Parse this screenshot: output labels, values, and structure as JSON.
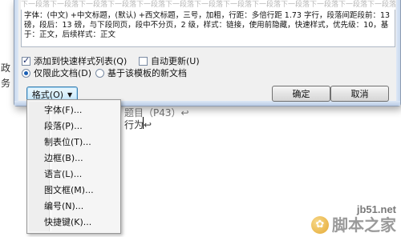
{
  "document": {
    "left_text_1": "政",
    "left_text_2": "务",
    "line_1": "题目（P43）↩",
    "line_2": "行为↩"
  },
  "dialog": {
    "preview_strip": "下一段落下一段落下一段落下一段落下一段落下一段落下一段落下一段落下一段落下一段落下一段落下一段落下一段落下一段落",
    "description": "字体：(中文) +中文标题，(默认) +西文标题，三号，加粗，行距：多倍行距 1.73 字行，段落间距段前：13 磅，段后：13 磅，与下段同页，段中不分页，2 级，样式：链接，使用前隐藏，快速样式，优先级：10，基于：正文，后续样式：正文",
    "add_to_quick_style_label": "添加到快速样式列表(Q)",
    "add_to_quick_style_checked": true,
    "auto_update_label": "自动更新(U)",
    "auto_update_checked": false,
    "only_this_document_label": "仅限此文档(D)",
    "only_this_document_selected": true,
    "template_based_label": "基于该模板的新文档",
    "template_based_selected": false,
    "format_button_label": "格式(O)",
    "ok_button_label": "确定",
    "cancel_button_label": "取消"
  },
  "format_menu": {
    "items": [
      {
        "label": "字体(F)..."
      },
      {
        "label": "段落(P)..."
      },
      {
        "label": "制表位(T)..."
      },
      {
        "label": "边框(B)..."
      },
      {
        "label": "语言(L)..."
      },
      {
        "label": "图文框(M)..."
      },
      {
        "label": "编号(N)..."
      },
      {
        "label": "快捷键(K)..."
      }
    ]
  },
  "watermark": {
    "site": "jb51.net",
    "name": "脚本之家"
  },
  "colors": {
    "dialog_bg": "#f0f0f0",
    "frame_blue": "#c9d8ee",
    "radio_blue": "#1a5fb4"
  }
}
